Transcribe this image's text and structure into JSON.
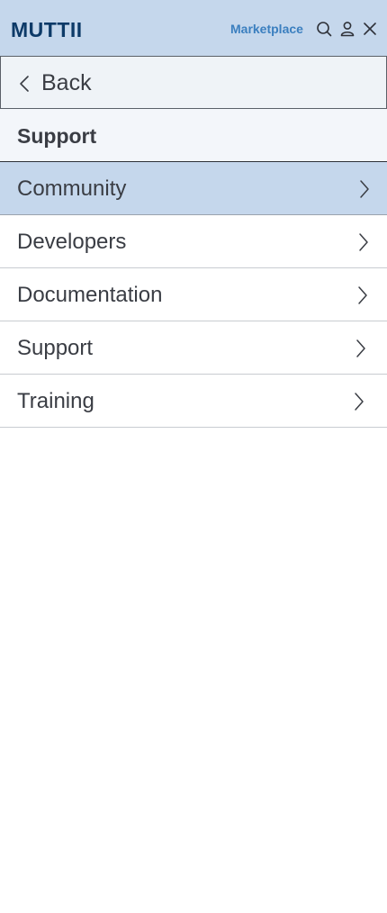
{
  "header": {
    "logo": "MUTTII",
    "marketplace_label": "Marketplace",
    "icons": [
      "search-icon",
      "user-icon",
      "close-icon"
    ],
    "background_color": "#c5d7ec",
    "logo_color": "#0d3a68",
    "link_color": "#3b7fbf"
  },
  "nav": {
    "back_label": "Back",
    "section_title": "Support",
    "items": [
      {
        "label": "Community",
        "active": true
      },
      {
        "label": "Developers",
        "active": false
      },
      {
        "label": "Documentation",
        "active": false
      },
      {
        "label": "Support",
        "active": false
      },
      {
        "label": "Training",
        "active": false
      }
    ]
  }
}
